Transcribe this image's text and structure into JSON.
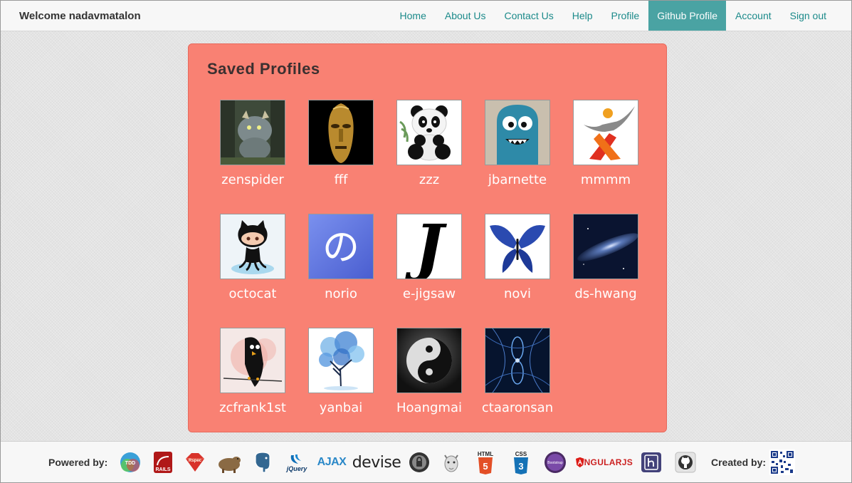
{
  "navbar": {
    "welcome": "Welcome nadavmatalon",
    "links": [
      {
        "label": "Home"
      },
      {
        "label": "About Us"
      },
      {
        "label": "Contact Us"
      },
      {
        "label": "Help"
      },
      {
        "label": "Profile"
      },
      {
        "label": "Github Profile",
        "active": true
      },
      {
        "label": "Account"
      },
      {
        "label": "Sign out"
      }
    ]
  },
  "panel": {
    "title": "Saved Profiles",
    "profiles": [
      {
        "name": "zenspider",
        "icon": "wild-thing-avatar"
      },
      {
        "name": "fff",
        "icon": "golden-mask-avatar"
      },
      {
        "name": "zzz",
        "icon": "panda-avatar"
      },
      {
        "name": "jbarnette",
        "icon": "blue-monster-avatar"
      },
      {
        "name": "mmmm",
        "icon": "x-logo-avatar"
      },
      {
        "name": "octocat",
        "icon": "octocat-avatar"
      },
      {
        "name": "norio",
        "icon": "no-character-avatar"
      },
      {
        "name": "e-jigsaw",
        "icon": "letter-j-avatar"
      },
      {
        "name": "novi",
        "icon": "butterfly-avatar"
      },
      {
        "name": "ds-hwang",
        "icon": "galaxy-avatar"
      },
      {
        "name": "zcfrank1st",
        "icon": "black-bird-avatar"
      },
      {
        "name": "yanbai",
        "icon": "blue-tree-avatar"
      },
      {
        "name": "Hoangmai",
        "icon": "yin-yang-avatar"
      },
      {
        "name": "ctaaronsan",
        "icon": "fractal-avatar"
      }
    ]
  },
  "footer": {
    "powered_by": "Powered by:",
    "created_by": "Created by:",
    "technologies": [
      {
        "label": "TDD",
        "icon": "tdd-icon"
      },
      {
        "label": "RAILS",
        "icon": "rails-icon"
      },
      {
        "label": "Rspec",
        "icon": "rspec-icon"
      },
      {
        "label": "",
        "icon": "capybara-icon"
      },
      {
        "label": "",
        "icon": "postgresql-icon"
      },
      {
        "label": "jQuery",
        "icon": "jquery-icon"
      },
      {
        "label": "AJAX",
        "icon": "ajax-icon"
      },
      {
        "label": "devise",
        "icon": "devise-icon"
      },
      {
        "label": "",
        "icon": "poltergeist-icon"
      },
      {
        "label": "",
        "icon": "faker-icon"
      },
      {
        "label": "HTML",
        "icon": "html5-icon"
      },
      {
        "label": "CSS",
        "icon": "css3-icon"
      },
      {
        "label": "Bootstrap",
        "icon": "bootstrap-icon"
      },
      {
        "label": "NGULARJS",
        "icon": "angularjs-icon"
      },
      {
        "label": "",
        "icon": "heroku-icon"
      },
      {
        "label": "",
        "icon": "github-icon"
      }
    ],
    "qr_icon": "qr-code-icon"
  },
  "colors": {
    "panel_bg": "#f98173",
    "nav_link": "#1b8a8a",
    "nav_active_bg": "#4aa3a3"
  }
}
